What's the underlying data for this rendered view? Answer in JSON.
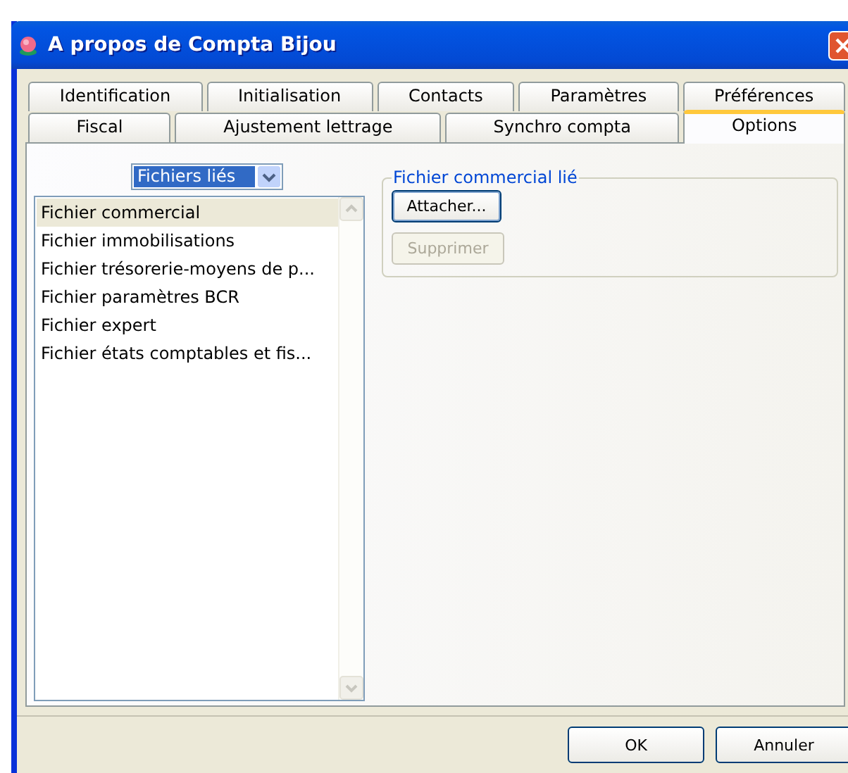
{
  "window": {
    "title": "A propos de Compta Bijou"
  },
  "tab_rows": [
    {
      "tabs": [
        {
          "label": "Identification",
          "selected": false
        },
        {
          "label": "Initialisation",
          "selected": false
        },
        {
          "label": "Contacts",
          "selected": false
        },
        {
          "label": "Paramètres",
          "selected": false
        },
        {
          "label": "Préférences",
          "selected": false
        }
      ]
    },
    {
      "tabs": [
        {
          "label": "Fiscal",
          "selected": false
        },
        {
          "label": "Ajustement lettrage",
          "selected": false
        },
        {
          "label": "Synchro compta",
          "selected": false
        },
        {
          "label": "Options",
          "selected": true
        }
      ]
    }
  ],
  "file_type_dropdown": {
    "value": "Fichiers liés"
  },
  "file_list": {
    "items": [
      {
        "label": "Fichier commercial",
        "selected": true
      },
      {
        "label": "Fichier immobilisations",
        "selected": false
      },
      {
        "label": "Fichier trésorerie-moyens de p...",
        "selected": false
      },
      {
        "label": "Fichier paramètres BCR",
        "selected": false
      },
      {
        "label": "Fichier expert",
        "selected": false
      },
      {
        "label": "Fichier états comptables et fis...",
        "selected": false
      }
    ]
  },
  "group": {
    "title": "Fichier commercial lié",
    "buttons": [
      {
        "label": "Attacher...",
        "disabled": false
      },
      {
        "label": "Supprimer",
        "disabled": true
      }
    ]
  },
  "buttons": [
    {
      "label": "OK",
      "disabled": false
    },
    {
      "label": "Annuler",
      "disabled": false
    }
  ]
}
